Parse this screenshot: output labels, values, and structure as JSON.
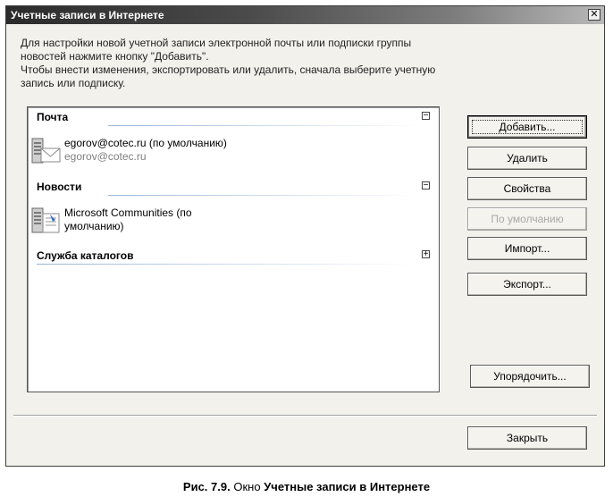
{
  "window": {
    "title": "Учетные записи в Интернете",
    "close_label": "✕"
  },
  "description": {
    "line1": "Для настройки новой учетной записи электронной почты или подписки группы",
    "line2": "новостей нажмите кнопку \"Добавить\".",
    "line3": "Чтобы внести изменения, экспортировать или удалить, сначала выберите учетную",
    "line4": "запись или подписку."
  },
  "groups": {
    "mail": {
      "title": "Почта",
      "toggle": "−",
      "account": {
        "line1": "egorov@cotec.ru (по умолчанию)",
        "line2": "egorov@cotec.ru"
      }
    },
    "news": {
      "title": "Новости",
      "toggle": "−",
      "account": {
        "line1": "Microsoft Communities (по",
        "line2": "умолчанию)"
      }
    },
    "directory": {
      "title": "Служба каталогов",
      "toggle": "+"
    }
  },
  "buttons": {
    "add": "Добавить...",
    "delete": "Удалить",
    "properties": "Свойства",
    "set_default": "По умолчанию",
    "import": "Импорт...",
    "export": "Экспорт...",
    "order": "Упорядочить...",
    "close": "Закрыть"
  },
  "caption": {
    "prefix": "Рис. 7.9.",
    "middle": "Окно",
    "name": "Учетные записи в Интернете"
  }
}
